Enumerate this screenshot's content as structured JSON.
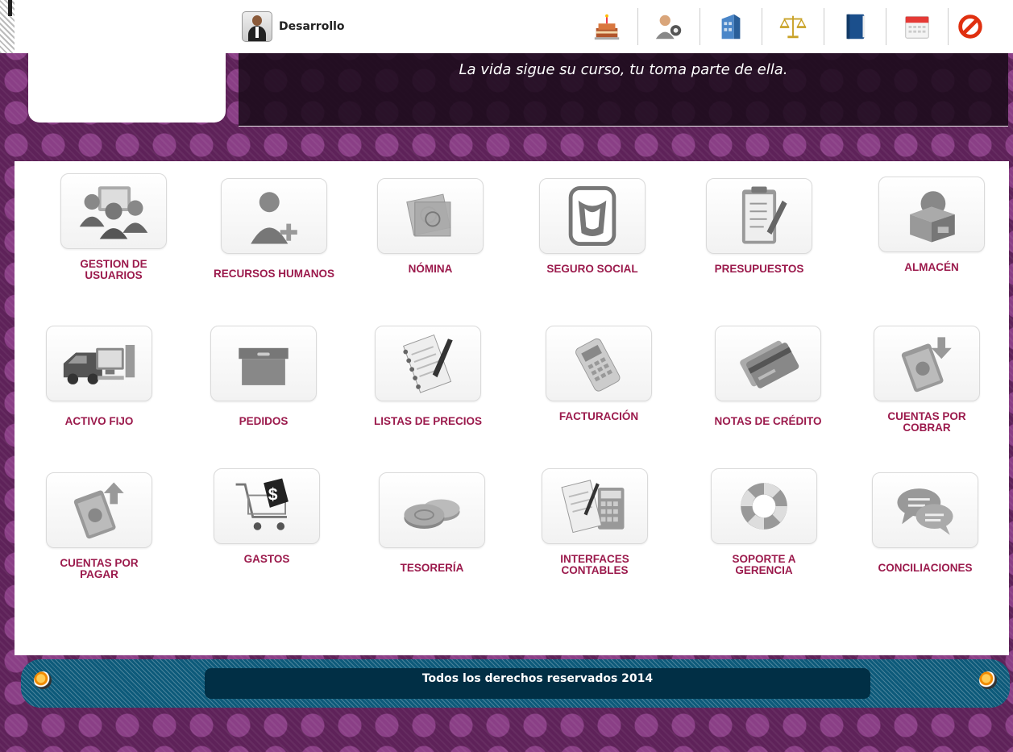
{
  "user": {
    "name": "Desarrollo"
  },
  "toolbar": [
    {
      "icon": "birthday-cake-icon"
    },
    {
      "icon": "user-settings-icon"
    },
    {
      "icon": "building-icon"
    },
    {
      "icon": "scales-icon"
    },
    {
      "icon": "book-icon"
    },
    {
      "icon": "calendar-icon"
    },
    {
      "icon": "exit-icon"
    }
  ],
  "banner": {
    "slogan": "La vida sigue su curso, tu toma parte de ella."
  },
  "modules": [
    {
      "label": "GESTION DE\nUSUARIOS",
      "icon": "users-icon"
    },
    {
      "label": "RECURSOS HUMANOS",
      "icon": "add-person-icon"
    },
    {
      "label": "NÓMINA",
      "icon": "money-icon"
    },
    {
      "label": "SEGURO SOCIAL",
      "icon": "social-security-icon"
    },
    {
      "label": "PRESUPUESTOS",
      "icon": "clipboard-icon"
    },
    {
      "label": "ALMACÉN",
      "icon": "warehouse-box-icon"
    },
    {
      "label": "ACTIVO FIJO",
      "icon": "truck-computer-icon"
    },
    {
      "label": "PEDIDOS",
      "icon": "box-icon"
    },
    {
      "label": "LISTAS DE PRECIOS",
      "icon": "notepad-icon"
    },
    {
      "label": "FACTURACIÓN",
      "icon": "card-terminal-icon"
    },
    {
      "label": "NOTAS DE CRÉDITO",
      "icon": "credit-card-icon"
    },
    {
      "label": "CUENTAS POR\nCOBRAR",
      "icon": "receivable-icon"
    },
    {
      "label": "CUENTAS POR\nPAGAR",
      "icon": "payable-icon"
    },
    {
      "label": "GASTOS",
      "icon": "shopping-cart-icon"
    },
    {
      "label": "TESORERÍA",
      "icon": "coins-icon"
    },
    {
      "label": "INTERFACES\nCONTABLES",
      "icon": "calculator-notebook-icon"
    },
    {
      "label": "SOPORTE A\nGERENCIA",
      "icon": "lifebuoy-icon"
    },
    {
      "label": "CONCILIACIONES",
      "icon": "chat-bubbles-icon"
    }
  ],
  "footer": {
    "text": "Todos los derechos reservados 2014"
  },
  "colors": {
    "accent": "#9b1a4c",
    "background": "#6a2a66",
    "footer": "#0d5a7a"
  }
}
